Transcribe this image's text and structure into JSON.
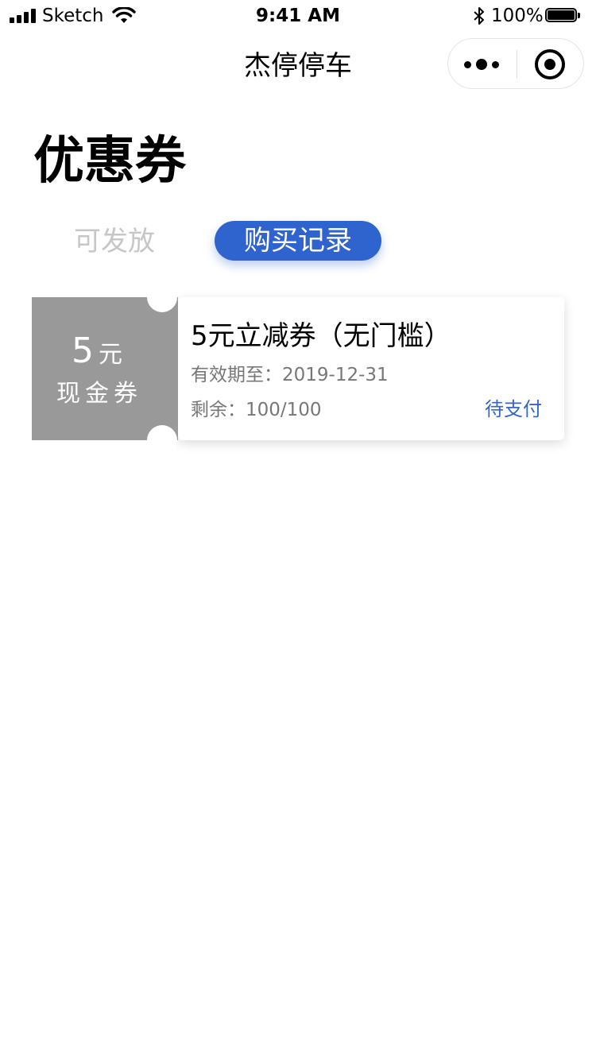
{
  "status_bar": {
    "carrier": "Sketch",
    "time": "9:41 AM",
    "battery_percent": "100%",
    "icons": [
      "signal-icon",
      "wifi-icon",
      "bluetooth-icon",
      "battery-icon"
    ]
  },
  "nav": {
    "title": "杰停停车",
    "icons": [
      "more-icon",
      "close-miniprogram-icon"
    ]
  },
  "page": {
    "title": "优惠券"
  },
  "tabs": [
    {
      "label": "可发放",
      "active": false
    },
    {
      "label": "购买记录",
      "active": true
    }
  ],
  "coupons": [
    {
      "amount": "5",
      "unit": "元",
      "type": "现金券",
      "name": "5元立减券（无门槛）",
      "validity": "有效期至：2019-12-31",
      "remaining": "剩余：100/100",
      "status": "待支付"
    }
  ],
  "colors": {
    "accent": "#2f64ce",
    "status_link": "#3366cc",
    "coupon_stub": "#999999",
    "inactive_tab": "#c7c7c7"
  }
}
